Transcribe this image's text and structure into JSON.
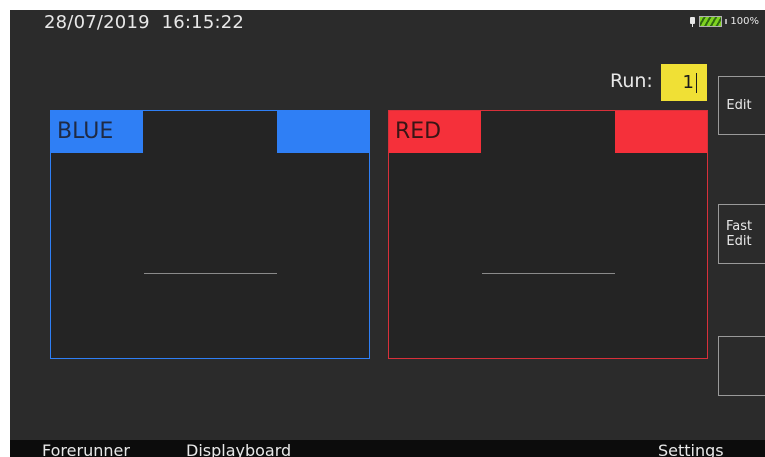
{
  "status_bar": {
    "date": "28/07/2019",
    "time": "16:15:22",
    "battery_percent": "100%"
  },
  "run": {
    "label": "Run:",
    "value": "1"
  },
  "panels": [
    {
      "name": "BLUE",
      "color": "#2f7ff5"
    },
    {
      "name": "RED",
      "color": "#f5303a"
    }
  ],
  "side_buttons": [
    {
      "label": "Edit"
    },
    {
      "label": "Fast Edit"
    },
    {
      "label": ""
    }
  ],
  "bottom_tabs": [
    "Forerunner",
    "Displayboard",
    "Settings"
  ]
}
